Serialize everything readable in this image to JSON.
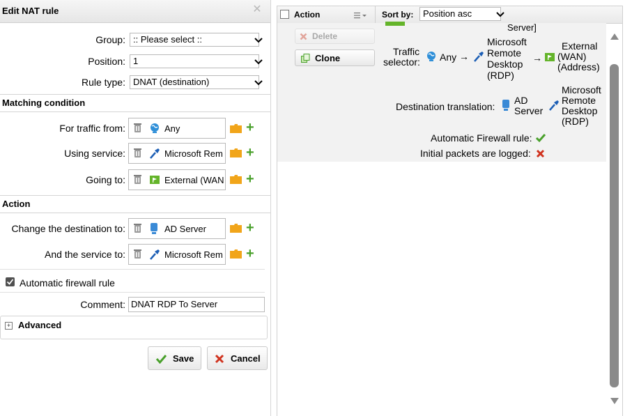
{
  "dialog": {
    "title": "Edit NAT rule",
    "group": {
      "label": "Group:",
      "value": ":: Please select ::"
    },
    "position": {
      "label": "Position:",
      "value": "1"
    },
    "rule_type": {
      "label": "Rule type:",
      "value": "DNAT (destination)"
    },
    "matching_condition": {
      "heading": "Matching condition",
      "traffic_from": {
        "label": "For traffic from:",
        "value": "Any",
        "icon": "network-globe-icon"
      },
      "using_service": {
        "label": "Using service:",
        "value": "Microsoft Rem",
        "icon": "service-plug-icon"
      },
      "going_to": {
        "label": "Going to:",
        "value": "External (WAN",
        "icon": "interface-flag-icon"
      }
    },
    "action": {
      "heading": "Action",
      "change_destination": {
        "label": "Change the destination to:",
        "value": "AD Server",
        "icon": "host-server-icon"
      },
      "and_service": {
        "label": "And the service to:",
        "value": "Microsoft Rem",
        "icon": "service-plug-icon"
      }
    },
    "automatic_firewall_rule": {
      "label": "Automatic firewall rule",
      "checked": true
    },
    "comment": {
      "label": "Comment:",
      "value": "DNAT RDP To Server"
    },
    "advanced": {
      "label": "Advanced"
    },
    "save_label": "Save",
    "cancel_label": "Cancel"
  },
  "rule_list": {
    "header": {
      "action_label": "Action",
      "sort_label": "Sort by:",
      "sort_value": "Position asc"
    },
    "buttons": {
      "delete_label": "Delete",
      "clone_label": "Clone"
    },
    "partial_top_text": "Server]",
    "traffic_selector": {
      "label_line1": "Traffic",
      "label_line2": "selector:",
      "source": "Any",
      "arrow": "→",
      "service_lines": [
        "Microsoft",
        "Remote",
        "Desktop",
        "(RDP)"
      ],
      "destination_lines": [
        "External",
        "(WAN)",
        "(Address)"
      ]
    },
    "destination_translation": {
      "label": "Destination translation:",
      "host_lines": [
        "AD",
        "Server"
      ],
      "service_lines": [
        "Microsoft",
        "Remote",
        "Desktop",
        "(RDP)"
      ]
    },
    "automatic_firewall_rule": {
      "label": "Automatic Firewall rule:",
      "status": "yes"
    },
    "initial_packets_logged": {
      "label": "Initial packets are logged:",
      "status": "no"
    }
  },
  "colors": {
    "accent_green": "#49a02b",
    "error_red": "#d0331f",
    "globe_blue": "#2f8fd8",
    "service_blue": "#1d5fb5",
    "flag_green": "#64b42a",
    "folder_orange": "#f1a51a",
    "card_bg": "#f2f2f2"
  }
}
